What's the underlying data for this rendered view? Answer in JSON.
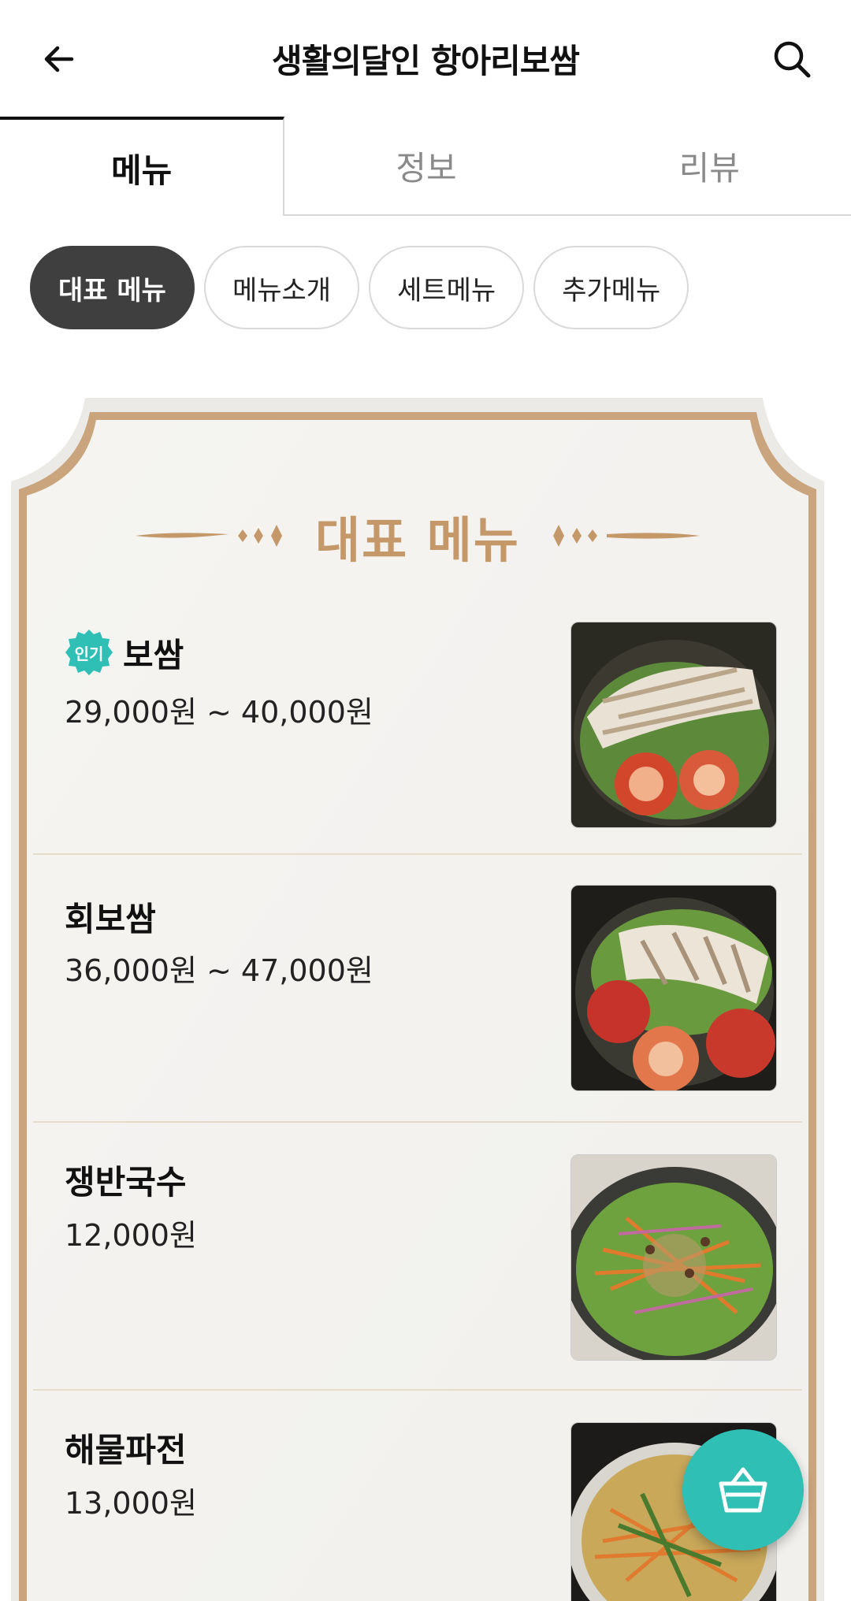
{
  "header": {
    "title": "생활의달인 항아리보쌈",
    "back_icon": "arrow-left-icon",
    "search_icon": "search-icon"
  },
  "tabs": [
    {
      "label": "메뉴",
      "active": true
    },
    {
      "label": "정보",
      "active": false
    },
    {
      "label": "리뷰",
      "active": false
    }
  ],
  "chips": [
    {
      "label": "대표 메뉴",
      "active": true
    },
    {
      "label": "메뉴소개",
      "active": false
    },
    {
      "label": "세트메뉴",
      "active": false
    },
    {
      "label": "추가메뉴",
      "active": false
    }
  ],
  "menu_section": {
    "heading": "대표 메뉴",
    "items": [
      {
        "name": "보쌈",
        "price": "29,000원 ~ 40,000원",
        "badge": "인기"
      },
      {
        "name": "회보쌈",
        "price": "36,000원 ~ 47,000원",
        "badge": ""
      },
      {
        "name": "쟁반국수",
        "price": "12,000원",
        "badge": ""
      },
      {
        "name": "해물파전",
        "price": "13,000원",
        "badge": ""
      }
    ]
  },
  "cart": {
    "icon": "basket-icon"
  },
  "colors": {
    "accent_gold": "#c49869",
    "card_border": "#c9a47c",
    "teal": "#2fbfb4",
    "chip_active": "#3f3f3f"
  }
}
